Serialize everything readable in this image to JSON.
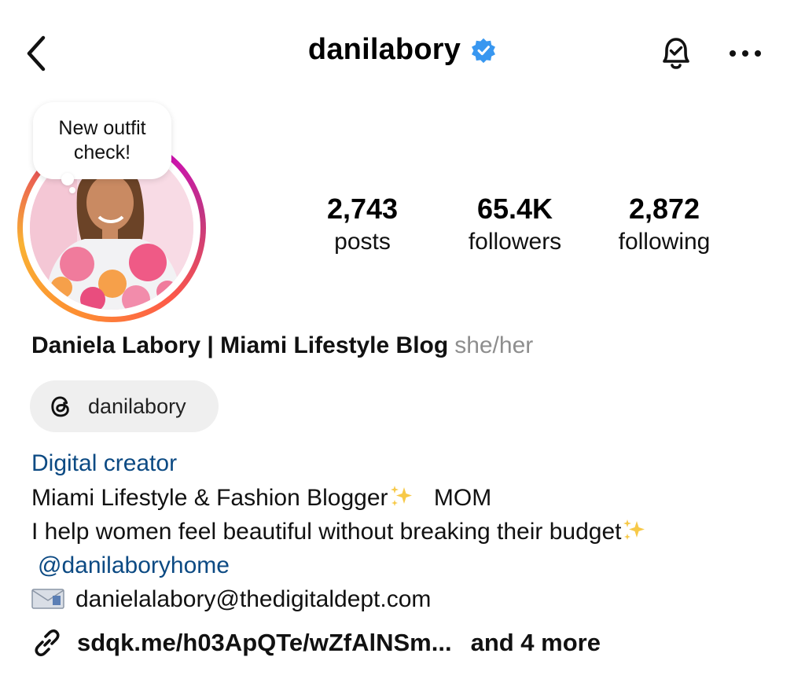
{
  "header": {
    "username": "danilabory",
    "verified_color": "#3897f0",
    "icons": {
      "back": "chevron-left-icon",
      "notifications": "bell-icon",
      "more": "more-horizontal-icon"
    }
  },
  "note": {
    "line1": "New outfit",
    "line2": "check!"
  },
  "stats": {
    "posts": {
      "value": "2,743",
      "label": "posts"
    },
    "followers": {
      "value": "65.4K",
      "label": "followers"
    },
    "following": {
      "value": "2,872",
      "label": "following"
    }
  },
  "profile": {
    "full_name": "Daniela Labory | Miami Lifestyle Blog",
    "pronouns": "she/her",
    "threads_handle": "danilabory",
    "category": "Digital creator",
    "bio": {
      "line1": "Miami Lifestyle & Fashion Blogger",
      "line1_suffix": "MOM",
      "line2": "I help women feel beautiful without breaking their budget",
      "mention": "@danilaboryhome",
      "email": "danielalabory@thedigitaldept.com"
    },
    "link": {
      "url": "sdqk.me/h03ApQTe/wZfAlNSm...",
      "more": "and 4 more"
    }
  },
  "colors": {
    "link_blue": "#0c4a83",
    "pronoun_gray": "#8e8e8e",
    "chip_bg": "#efefef"
  }
}
